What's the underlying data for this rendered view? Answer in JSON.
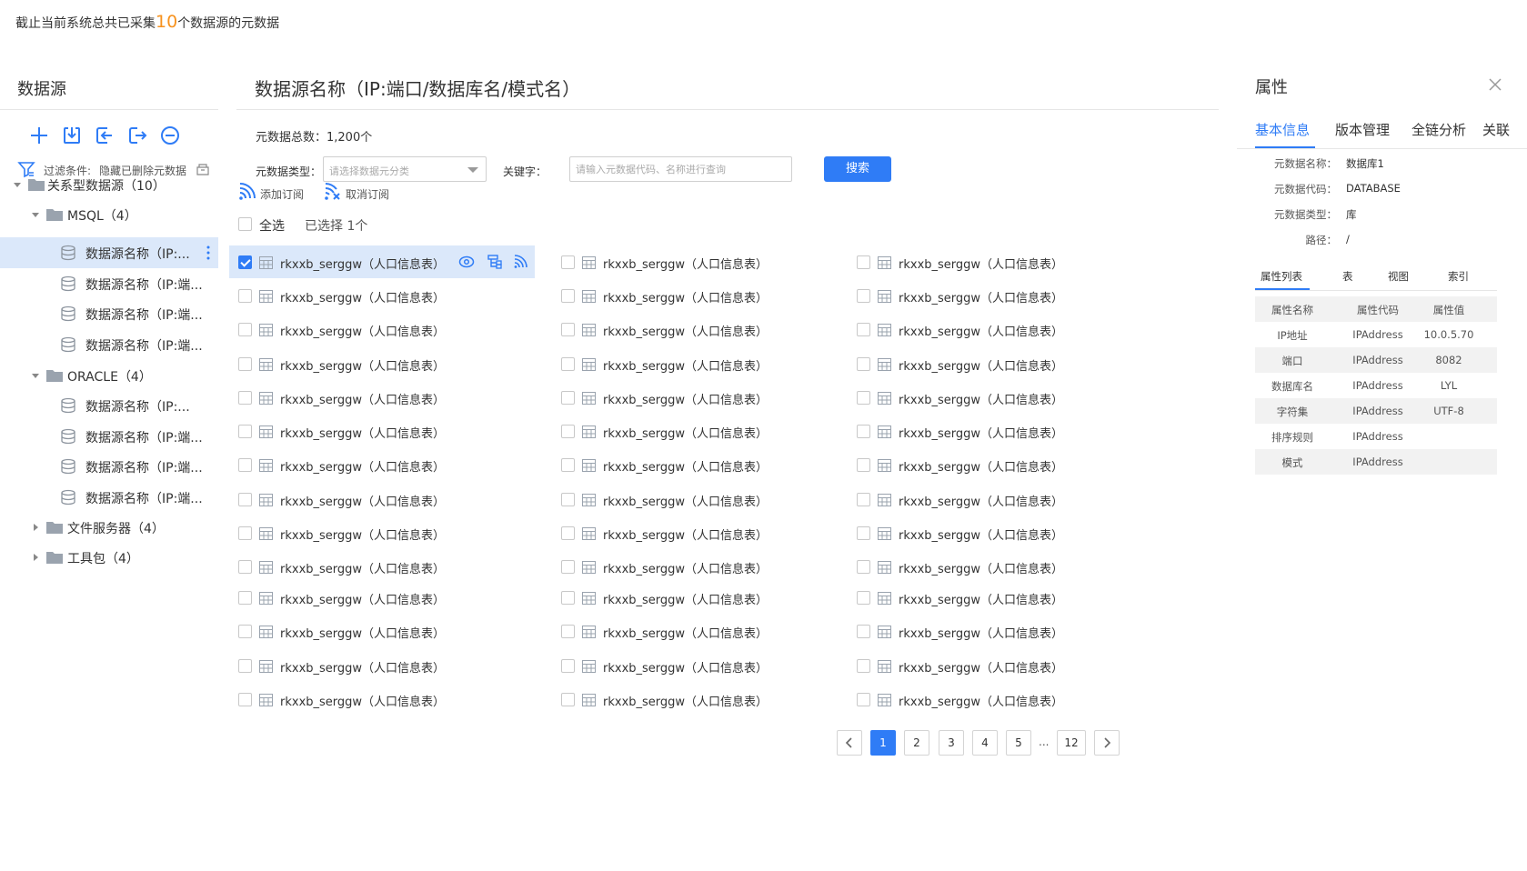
{
  "summary": {
    "prefix": "截止当前系统总共已采集",
    "count": "10",
    "suffix": "个数据源的元数据"
  },
  "left": {
    "title": "数据源",
    "toolbar_icons": [
      "add-icon",
      "import-icon",
      "login-icon",
      "logout-icon",
      "remove-icon"
    ],
    "filter": {
      "label": "过滤条件:",
      "value": "隐藏已删除元数据"
    },
    "tree": {
      "root": {
        "label": "关系型数据源",
        "count": "（10）"
      },
      "msql": {
        "label": "MSQL",
        "count": "（4）"
      },
      "msql_items": [
        "数据源名称（IP:...",
        "数据源名称（IP:端...",
        "数据源名称（IP:端...",
        "数据源名称（IP:端..."
      ],
      "oracle": {
        "label": "ORACLE",
        "count": "（4）"
      },
      "oracle_items": [
        "数据源名称（IP:...",
        "数据源名称（IP:端...",
        "数据源名称（IP:端...",
        "数据源名称（IP:端..."
      ],
      "file_server": {
        "label": "文件服务器",
        "count": "（4）"
      },
      "toolkit": {
        "label": "工具包",
        "count": "（4）"
      }
    }
  },
  "main": {
    "title": "数据源名称（IP:端口/数据库名/模式名）",
    "total": "元数据总数：1,200个",
    "type_label": "元数据类型：",
    "type_placeholder": "请选择数据元分类",
    "keyword_label": "关键字：",
    "keyword_placeholder": "请输入元数据代码、名称进行查询",
    "search_label": "搜索",
    "subscribe_label": "添加订阅",
    "unsubscribe_label": "取消订阅",
    "select_all_label": "全选",
    "selected_count": "已选择 1个",
    "table_name": "rkxxb_serggw（人口信息表）",
    "rows": 14,
    "columns": 3,
    "selected_cell": [
      0,
      0
    ],
    "selected_cell_icons": [
      "eye-icon",
      "lineage-icon",
      "subscribe-icon"
    ],
    "pagination": {
      "pages": [
        "1",
        "2",
        "3",
        "4",
        "5",
        "12"
      ],
      "current": "1",
      "ellipsis": "..."
    }
  },
  "right": {
    "title": "属性",
    "tabs": [
      "基本信息",
      "版本管理",
      "全链分析",
      "关联"
    ],
    "active_tab": "基本信息",
    "info": [
      {
        "label": "元数据名称：",
        "value": "数据库1"
      },
      {
        "label": "元数据代码：",
        "value": "DATABASE"
      },
      {
        "label": "元数据类型：",
        "value": "库"
      },
      {
        "label": "路径：",
        "value": "/"
      }
    ],
    "sub_tabs": [
      "属性列表",
      "表",
      "视图",
      "索引"
    ],
    "active_sub_tab": "属性列表",
    "table_headers": [
      "属性名称",
      "属性代码",
      "属性值"
    ],
    "table_rows": [
      [
        "IP地址",
        "IPAddress",
        "10.0.5.70"
      ],
      [
        "端口",
        "IPAddress",
        "8082"
      ],
      [
        "数据库名",
        "IPAddress",
        "LYL"
      ],
      [
        "字符集",
        "IPAddress",
        "UTF-8"
      ],
      [
        "排序规则",
        "IPAddress",
        ""
      ],
      [
        "模式",
        "IPAddress",
        ""
      ]
    ]
  },
  "colors": {
    "accent": "#2f7cf6",
    "highlight": "#f7921e",
    "selected_bg": "#dbe8fa"
  }
}
